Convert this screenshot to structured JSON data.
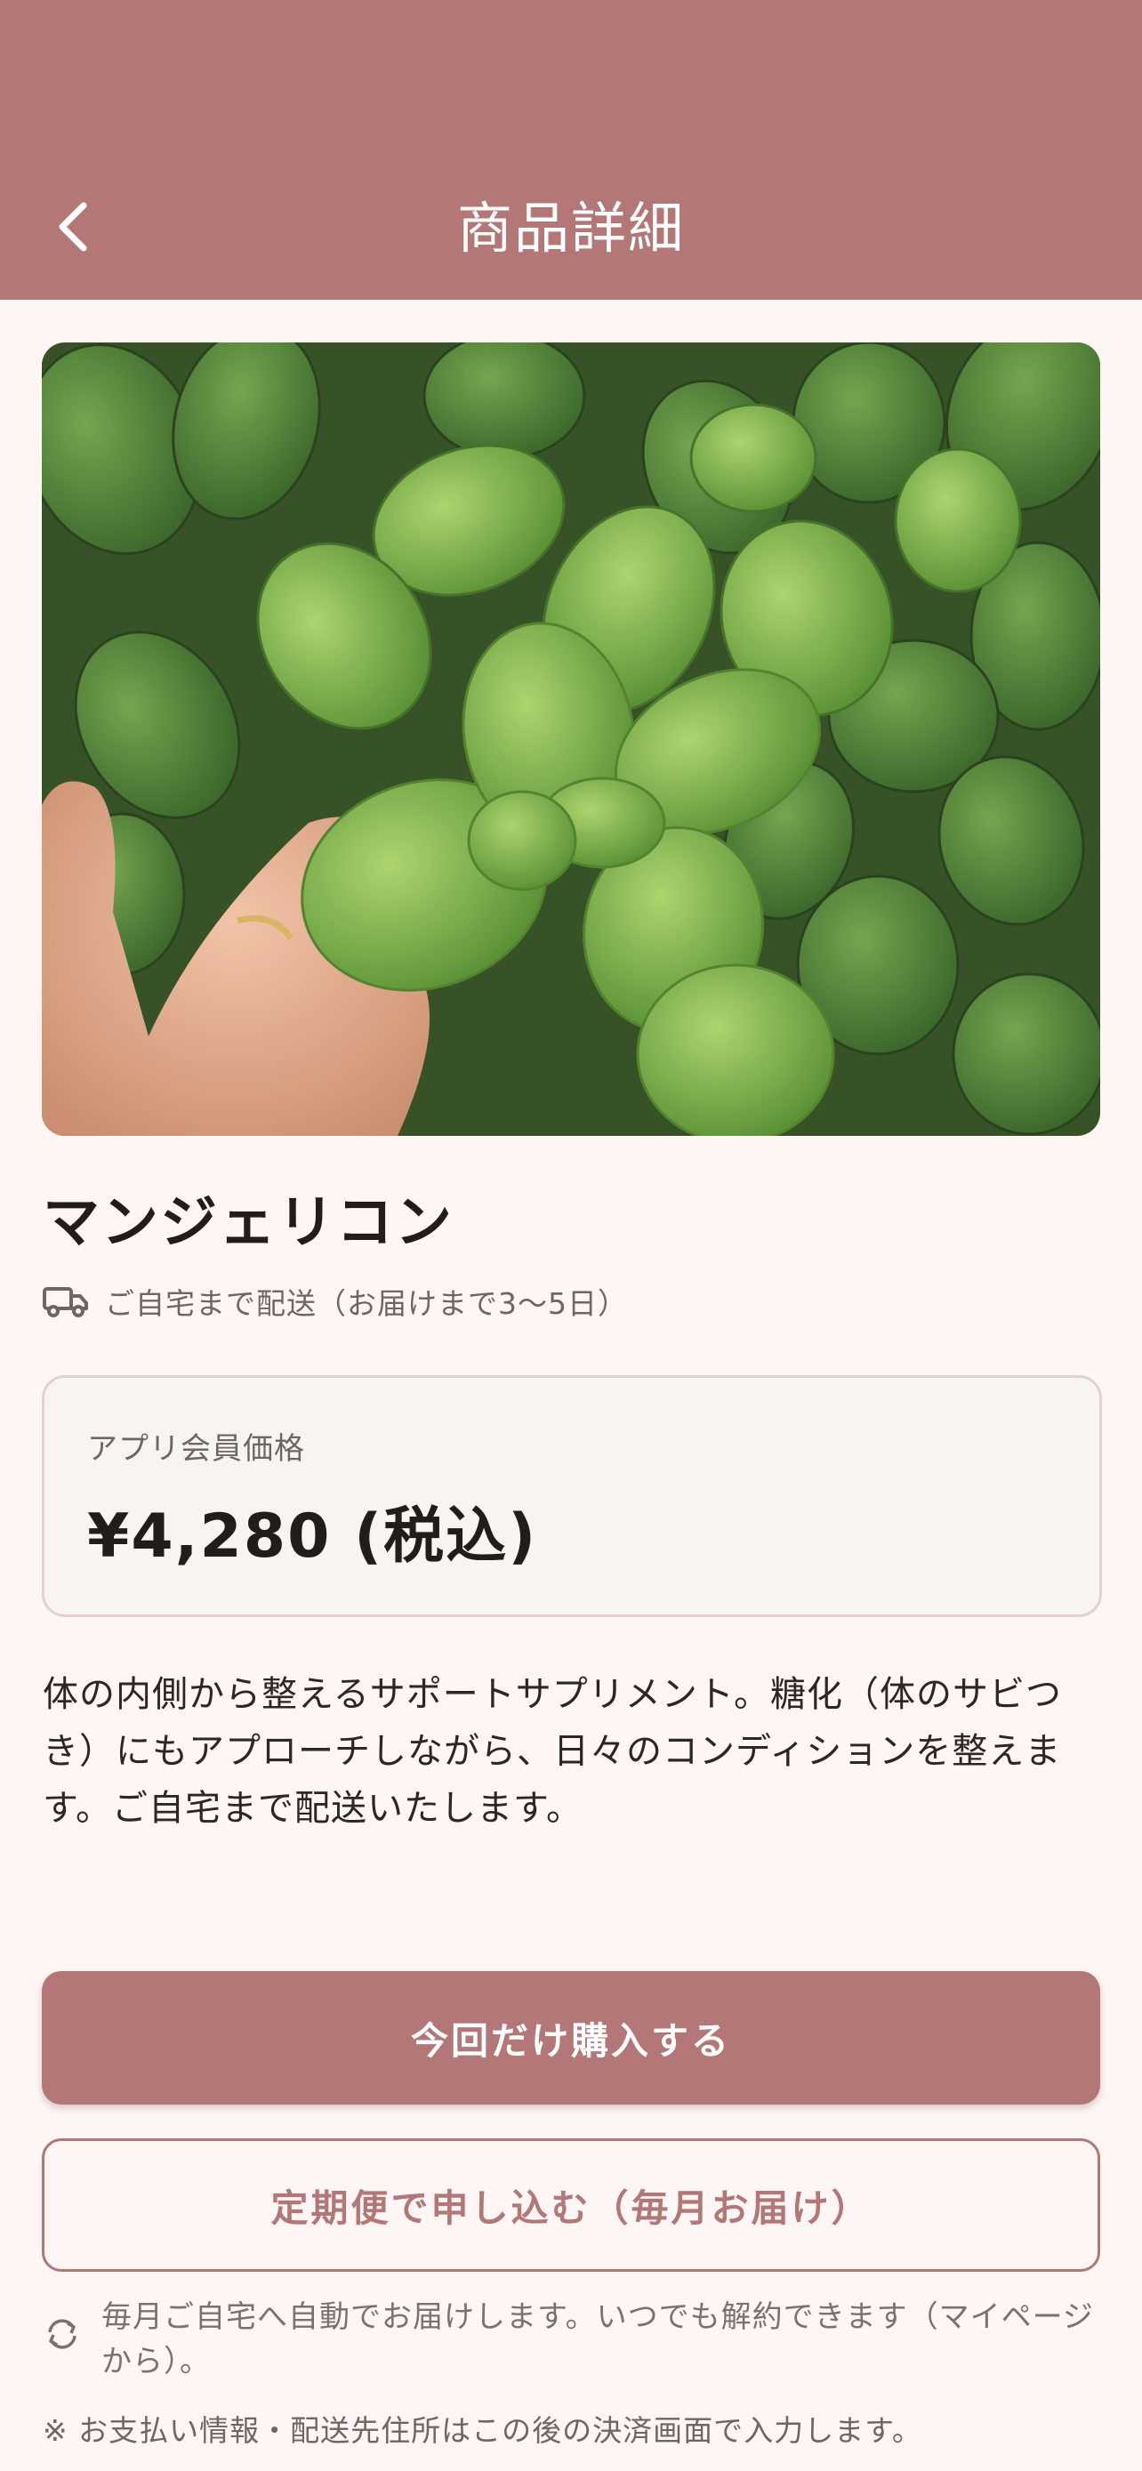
{
  "header": {
    "title": "商品詳細",
    "back_icon": "chevron-left-icon",
    "background": "#b37777"
  },
  "product": {
    "image_alt": "herb leaves photo",
    "name": "マンジェリコン",
    "shipping_icon": "truck-icon",
    "shipping_text": "ご自宅まで配送（お届けまで3〜5日）",
    "price_label": "アプリ会員価格",
    "price": "¥4,280 (税込)",
    "description": "体の内側から整えるサポートサプリメント。糖化（体のサビつき）にもアプローチしながら、日々のコンディションを整えます。ご自宅まで配送いたします。"
  },
  "actions": {
    "buy_once_label": "今回だけ購入する",
    "subscribe_label": "定期便で申し込む（毎月お届け）",
    "subscribe_note_icon": "refresh-icon",
    "subscribe_note": "毎月ご自宅へ自動でお届けします。いつでも解約できます（マイページから）。",
    "footnote": "※ お支払い情報・配送先住所はこの後の決済画面で入力します。"
  },
  "colors": {
    "accent": "#b37777",
    "page_background": "#fdf6f4",
    "card_border": "#e7cfcd"
  }
}
